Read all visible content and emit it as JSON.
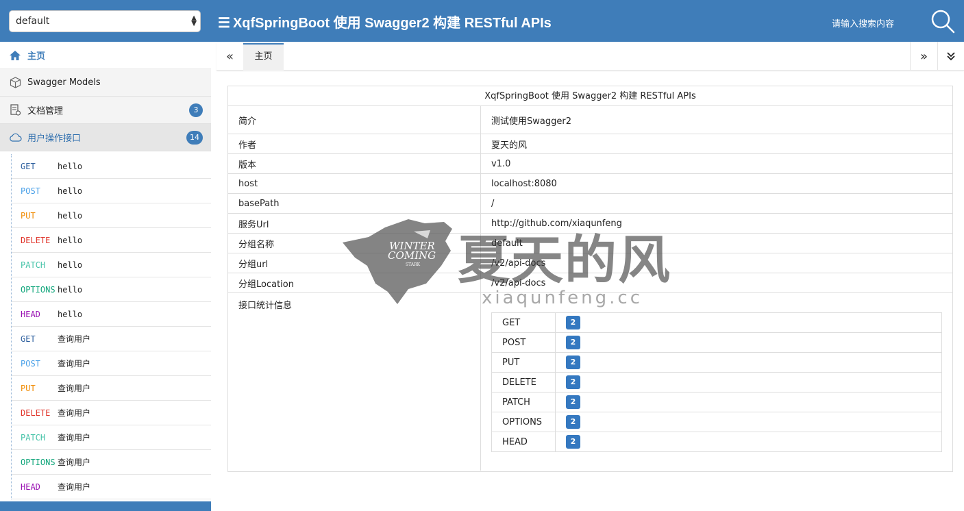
{
  "header": {
    "group_select_value": "default",
    "title": "XqfSpringBoot 使用 Swagger2 构建 RESTful APIs",
    "search_placeholder": "请输入搜索内容",
    "bg_color": "#3f7db9"
  },
  "sidebar": {
    "home_label": "主页",
    "models_label": "Swagger Models",
    "docs_label": "文档管理",
    "docs_count": "3",
    "api_group_label": "用户操作接口",
    "api_group_count": "14",
    "apis": [
      {
        "method": "GET",
        "path": "hello"
      },
      {
        "method": "POST",
        "path": "hello"
      },
      {
        "method": "PUT",
        "path": "hello"
      },
      {
        "method": "DELETE",
        "path": "hello"
      },
      {
        "method": "PATCH",
        "path": "hello"
      },
      {
        "method": "OPTIONS",
        "path": "hello"
      },
      {
        "method": "HEAD",
        "path": "hello"
      },
      {
        "method": "GET",
        "path": "查询用户"
      },
      {
        "method": "POST",
        "path": "查询用户"
      },
      {
        "method": "PUT",
        "path": "查询用户"
      },
      {
        "method": "DELETE",
        "path": "查询用户"
      },
      {
        "method": "PATCH",
        "path": "查询用户"
      },
      {
        "method": "OPTIONS",
        "path": "查询用户"
      },
      {
        "method": "HEAD",
        "path": "查询用户"
      }
    ]
  },
  "tabs": {
    "prev_icon": "«",
    "home_tab": "主页",
    "next_icon": "»"
  },
  "info": {
    "title": "XqfSpringBoot 使用 Swagger2 构建 RESTful APIs",
    "rows": [
      {
        "key": "简介",
        "value": "测试使用Swagger2"
      },
      {
        "key": "作者",
        "value": "夏天的风"
      },
      {
        "key": "版本",
        "value": "v1.0"
      },
      {
        "key": "host",
        "value": "localhost:8080"
      },
      {
        "key": "basePath",
        "value": "/"
      },
      {
        "key": "服务Url",
        "value": "http://github.com/xiaqunfeng"
      },
      {
        "key": "分组名称",
        "value": "default"
      },
      {
        "key": "分组url",
        "value": "/v2/api-docs"
      },
      {
        "key": "分组Location",
        "value": "/v2/api-docs"
      }
    ],
    "stats_label": "接口统计信息",
    "stats": [
      {
        "method": "GET",
        "count": "2"
      },
      {
        "method": "POST",
        "count": "2"
      },
      {
        "method": "PUT",
        "count": "2"
      },
      {
        "method": "DELETE",
        "count": "2"
      },
      {
        "method": "PATCH",
        "count": "2"
      },
      {
        "method": "OPTIONS",
        "count": "2"
      },
      {
        "method": "HEAD",
        "count": "2"
      }
    ]
  },
  "watermark": {
    "logo_line1": "WINTER",
    "logo_line2": "COMING",
    "logo_line3": "STARK",
    "name": "夏天的风",
    "url": "xiaqunfeng.cc"
  }
}
